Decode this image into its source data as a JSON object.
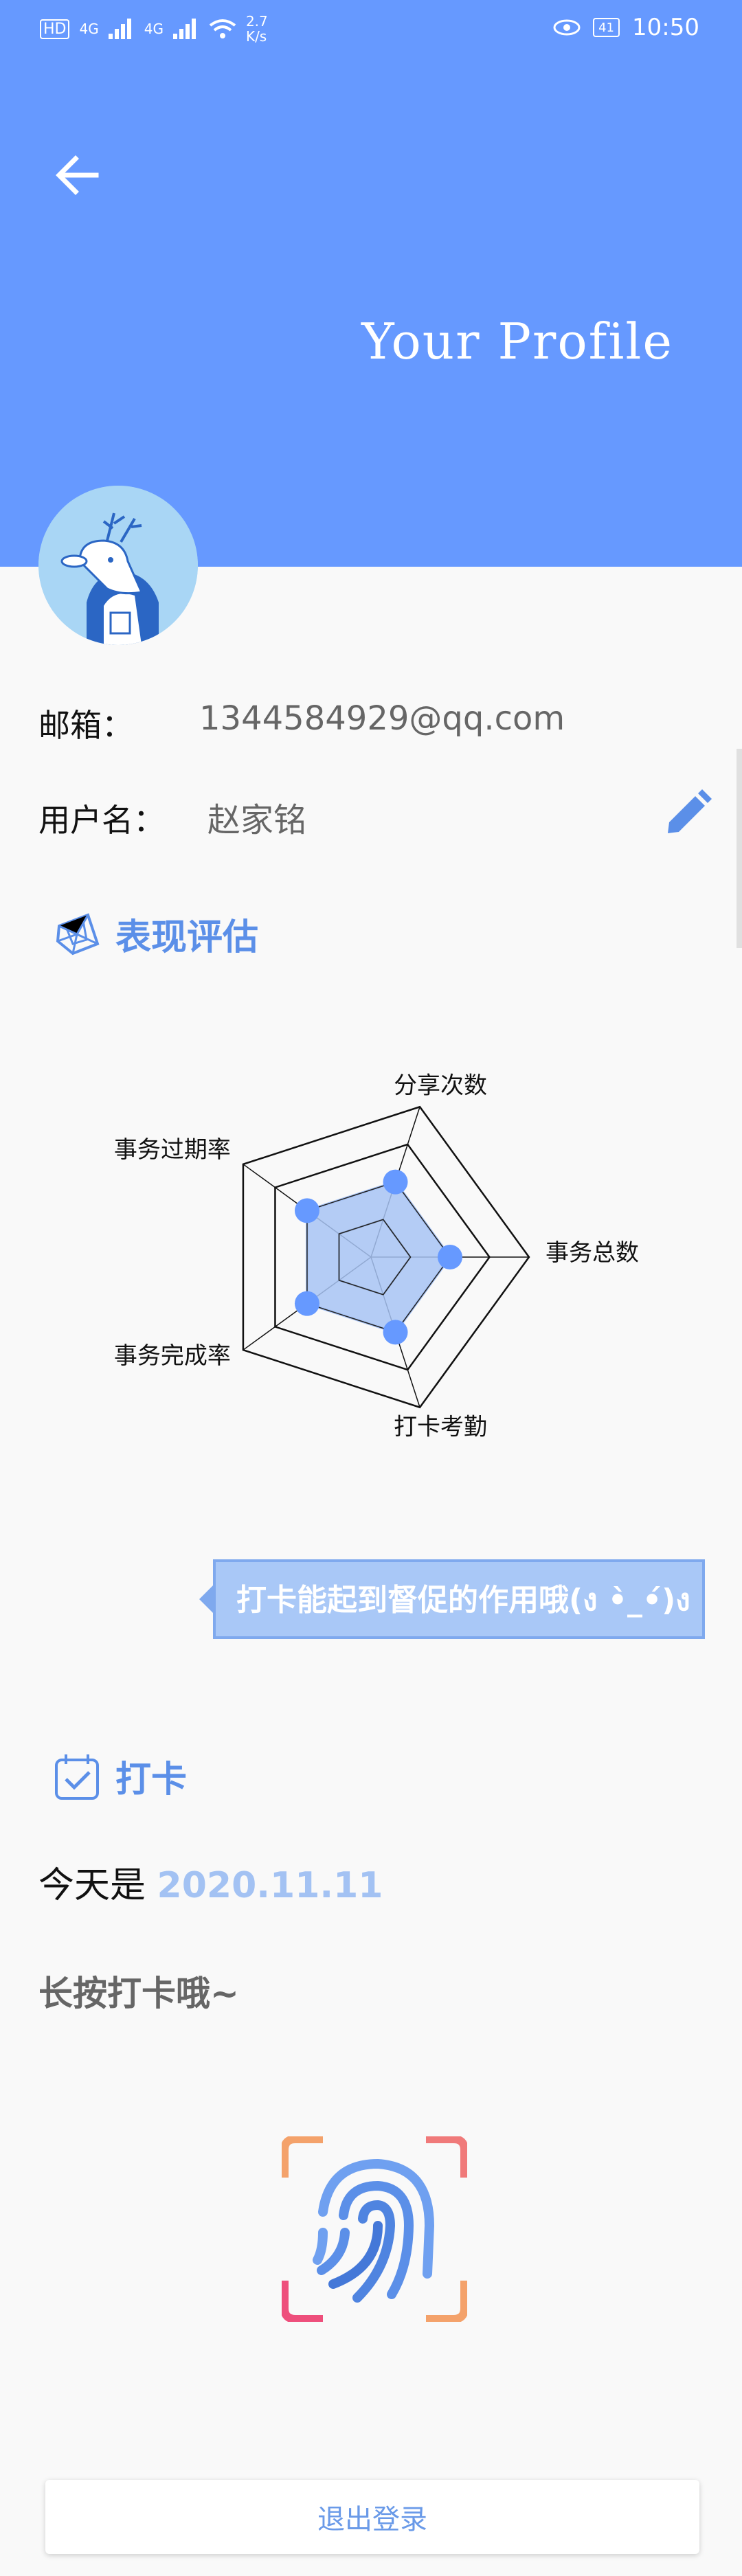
{
  "status": {
    "left_hd": "HD",
    "net1": "4G",
    "net2": "4G",
    "speed_top": "2.7",
    "speed_bottom": "K/s",
    "battery": "41",
    "time": "10:50"
  },
  "header": {
    "title": "Your Profile",
    "back_icon": "arrow-left-icon"
  },
  "profile": {
    "email_label": "邮箱：",
    "email_value": "1344584929@qq.com",
    "username_label": "用户名：",
    "username_value": "赵家铭",
    "edit_icon": "pencil-icon"
  },
  "evaluation": {
    "title": "表现评估",
    "icon": "radar-icon"
  },
  "chart_data": {
    "type": "radar",
    "axes": [
      "分享次数",
      "事务总数",
      "打卡考勤",
      "事务完成率",
      "事务过期率"
    ],
    "max": 4,
    "levels": 4,
    "values": [
      2,
      2,
      2,
      2,
      2
    ],
    "area_color": "#a8c4f5",
    "point_color": "#6699ff"
  },
  "tooltip": {
    "text": "打卡能起到督促的作用哦(ง •̀_•́)ง"
  },
  "checkin": {
    "title": "打卡",
    "icon": "calendar-check-icon",
    "today_prefix": "今天是 ",
    "today_date": "2020.11.11",
    "hint": "长按打卡哦~",
    "fingerprint_icon": "fingerprint-icon"
  },
  "logout": {
    "label": "退出登录"
  }
}
